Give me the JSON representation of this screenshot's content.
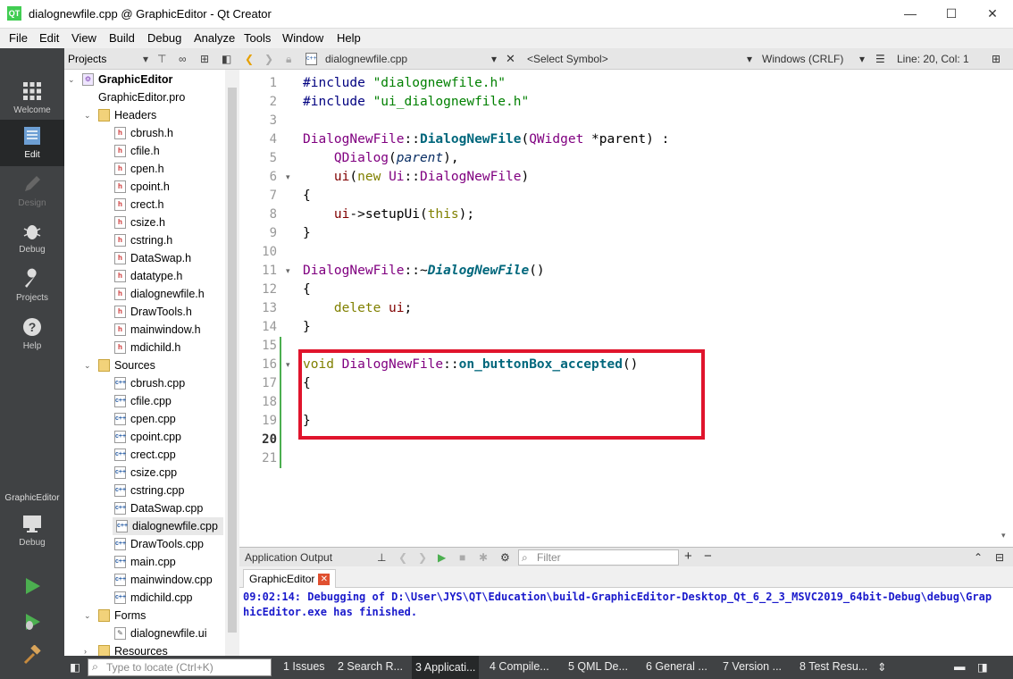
{
  "window": {
    "title": "dialognewfile.cpp @ GraphicEditor - Qt Creator",
    "app_icon": "QT",
    "minimize": "—",
    "maximize": "☐",
    "close": "✕"
  },
  "menu": [
    "File",
    "Edit",
    "View",
    "Build",
    "Debug",
    "Analyze",
    "Tools",
    "Window",
    "Help"
  ],
  "modes": {
    "welcome": "Welcome",
    "edit": "Edit",
    "design": "Design",
    "debug": "Debug",
    "projects": "Projects",
    "help": "Help",
    "kit_project": "GraphicEditor",
    "kit_mode": "Debug"
  },
  "project_panel": {
    "title": "Projects",
    "tree": [
      {
        "label": "GraphicEditor",
        "kind": "project"
      },
      {
        "label": "GraphicEditor.pro",
        "kind": "pro"
      },
      {
        "label": "Headers",
        "kind": "folder"
      },
      {
        "label": "cbrush.h",
        "kind": "h"
      },
      {
        "label": "cfile.h",
        "kind": "h"
      },
      {
        "label": "cpen.h",
        "kind": "h"
      },
      {
        "label": "cpoint.h",
        "kind": "h"
      },
      {
        "label": "crect.h",
        "kind": "h"
      },
      {
        "label": "csize.h",
        "kind": "h"
      },
      {
        "label": "cstring.h",
        "kind": "h"
      },
      {
        "label": "DataSwap.h",
        "kind": "h"
      },
      {
        "label": "datatype.h",
        "kind": "h"
      },
      {
        "label": "dialognewfile.h",
        "kind": "h"
      },
      {
        "label": "DrawTools.h",
        "kind": "h"
      },
      {
        "label": "mainwindow.h",
        "kind": "h"
      },
      {
        "label": "mdichild.h",
        "kind": "h"
      },
      {
        "label": "Sources",
        "kind": "folder"
      },
      {
        "label": "cbrush.cpp",
        "kind": "cpp"
      },
      {
        "label": "cfile.cpp",
        "kind": "cpp"
      },
      {
        "label": "cpen.cpp",
        "kind": "cpp"
      },
      {
        "label": "cpoint.cpp",
        "kind": "cpp"
      },
      {
        "label": "crect.cpp",
        "kind": "cpp"
      },
      {
        "label": "csize.cpp",
        "kind": "cpp"
      },
      {
        "label": "cstring.cpp",
        "kind": "cpp"
      },
      {
        "label": "DataSwap.cpp",
        "kind": "cpp"
      },
      {
        "label": "dialognewfile.cpp",
        "kind": "cpp",
        "selected": true
      },
      {
        "label": "DrawTools.cpp",
        "kind": "cpp"
      },
      {
        "label": "main.cpp",
        "kind": "cpp"
      },
      {
        "label": "mainwindow.cpp",
        "kind": "cpp"
      },
      {
        "label": "mdichild.cpp",
        "kind": "cpp"
      },
      {
        "label": "Forms",
        "kind": "folder"
      },
      {
        "label": "dialognewfile.ui",
        "kind": "ui"
      },
      {
        "label": "Resources",
        "kind": "folder"
      }
    ]
  },
  "editor_toolbar": {
    "file": "dialognewfile.cpp",
    "symbol": "<Select Symbol>",
    "encoding": "Windows (CRLF)",
    "position": "Line: 20, Col: 1"
  },
  "code": {
    "current_line": 20,
    "lines": [
      "1",
      "2",
      "3",
      "4",
      "5",
      "6",
      "7",
      "8",
      "9",
      "10",
      "11",
      "12",
      "13",
      "14",
      "15",
      "16",
      "17",
      "18",
      "19",
      "20",
      "21"
    ]
  },
  "output": {
    "title": "Application Output",
    "filter_placeholder": "Filter",
    "tab": "GraphicEditor",
    "text": "09:02:14: Debugging of D:\\User\\JYS\\QT\\Education\\build-GraphicEditor-Desktop_Qt_6_2_3_MSVC2019_64bit-Debug\\debug\\GraphicEditor.exe has finished."
  },
  "statusbar": {
    "locate_placeholder": "Type to locate (Ctrl+K)",
    "panes": [
      "1  Issues",
      "2  Search R...",
      "3  Applicati...",
      "4  Compile...",
      "5  QML De...",
      "6  General ...",
      "7  Version ...",
      "8  Test Resu..."
    ]
  }
}
